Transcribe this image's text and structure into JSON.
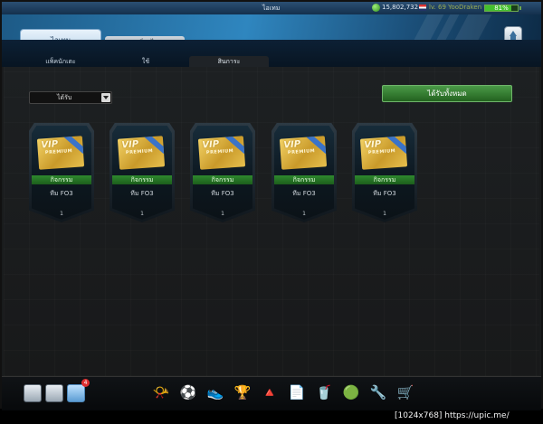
{
  "window": {
    "title": "ไอเทม"
  },
  "status": {
    "coins": "15,802,732",
    "user": "lv. 69 YooDraken",
    "battery": "81%",
    "battery_level": 0.81
  },
  "tabs": {
    "main": "ไอเทม",
    "exchange": "แลกเปลี่ยนไอเทม"
  },
  "subtabs": [
    "แพ็คนักเตะ",
    "ใช้",
    "สินการะ"
  ],
  "filter": {
    "selected": "ได้รับ"
  },
  "actions": {
    "receive_all": "ได้รับทั้งหมด"
  },
  "items": [
    {
      "vip": "VIP",
      "premium": "PREMIUM",
      "label": "กิจกรรม",
      "sub": "ทีม FO3",
      "qty": "1"
    },
    {
      "vip": "VIP",
      "premium": "PREMIUM",
      "label": "กิจกรรม",
      "sub": "ทีม FO3",
      "qty": "1"
    },
    {
      "vip": "VIP",
      "premium": "PREMIUM",
      "label": "กิจกรรม",
      "sub": "ทีม FO3",
      "qty": "1"
    },
    {
      "vip": "VIP",
      "premium": "PREMIUM",
      "label": "กิจกรรม",
      "sub": "ทีม FO3",
      "qty": "1"
    },
    {
      "vip": "VIP",
      "premium": "PREMIUM",
      "label": "กิจกรรม",
      "sub": "ทีม FO3",
      "qty": "1"
    }
  ],
  "bottom": {
    "badge": "4"
  },
  "dock": [
    {
      "name": "whistle-icon",
      "glyph": "📯"
    },
    {
      "name": "ball-icon",
      "glyph": "⚽"
    },
    {
      "name": "boots-icon",
      "glyph": "👟"
    },
    {
      "name": "trophy-icon",
      "glyph": "🏆"
    },
    {
      "name": "cone-icon",
      "glyph": "🔺"
    },
    {
      "name": "notes-icon",
      "glyph": "📄"
    },
    {
      "name": "cup-icon",
      "glyph": "🥤"
    },
    {
      "name": "club-badge-icon",
      "glyph": "🟢"
    },
    {
      "name": "tools-icon",
      "glyph": "🔧"
    },
    {
      "name": "cart-icon",
      "glyph": "🛒"
    }
  ],
  "watermark": "[1024x768] https://upic.me/"
}
